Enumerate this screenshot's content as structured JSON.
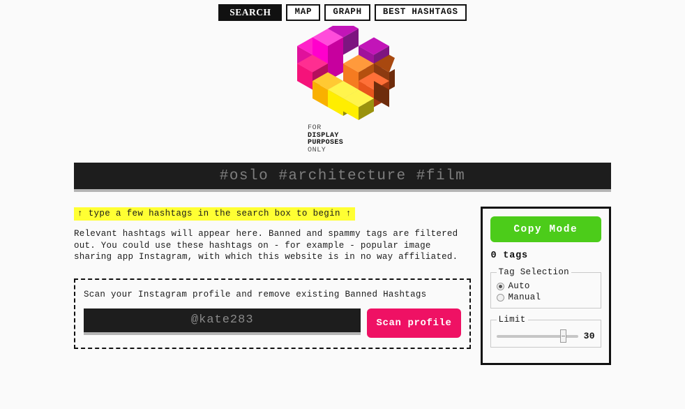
{
  "nav": {
    "items": [
      {
        "label": "SEARCH",
        "active": true
      },
      {
        "label": "MAP",
        "active": false
      },
      {
        "label": "GRAPH",
        "active": false
      },
      {
        "label": "BEST HASHTAGS",
        "active": false
      }
    ]
  },
  "logo": {
    "icon": "isometric-hashtag-logo",
    "line1": "FOR",
    "line2": "DISPLAY",
    "line3": "PURPOSES",
    "line4": "ONLY",
    "colors": {
      "magenta": "#ff00cc",
      "pink": "#f5137a",
      "purple": "#8e1a8e",
      "dark_magenta": "#b1108c",
      "orange": "#f57b20",
      "orange_dark": "#e8551c",
      "brown": "#8c3a10",
      "brown_dark": "#6e2c0c",
      "yellow": "#ffee00",
      "olive": "#8f8a0d",
      "gold": "#f9b000"
    }
  },
  "search": {
    "placeholder": "#oslo #architecture #film",
    "value": ""
  },
  "results": {
    "hint": "↑ type a few hashtags in the search box to begin ↑",
    "blurb": "Relevant hashtags will appear here. Banned and spammy tags are filtered out. You could use these hashtags on - for example - popular image sharing app Instagram, with which this website is in no way affiliated."
  },
  "scan": {
    "label": "Scan your Instagram profile and remove existing Banned Hashtags",
    "input_placeholder": "@kate283",
    "input_value": "",
    "button_label": "Scan profile",
    "button_color": "#ef1164"
  },
  "panel": {
    "copy_button_label": "Copy Mode",
    "copy_button_color": "#4ccc1a",
    "tag_count": "0 tags",
    "tag_selection": {
      "legend": "Tag Selection",
      "options": [
        {
          "label": "Auto",
          "selected": true
        },
        {
          "label": "Manual",
          "selected": false
        }
      ]
    },
    "limit": {
      "legend": "Limit",
      "value": "30",
      "min": 0,
      "max": 38,
      "percent": 78
    }
  }
}
